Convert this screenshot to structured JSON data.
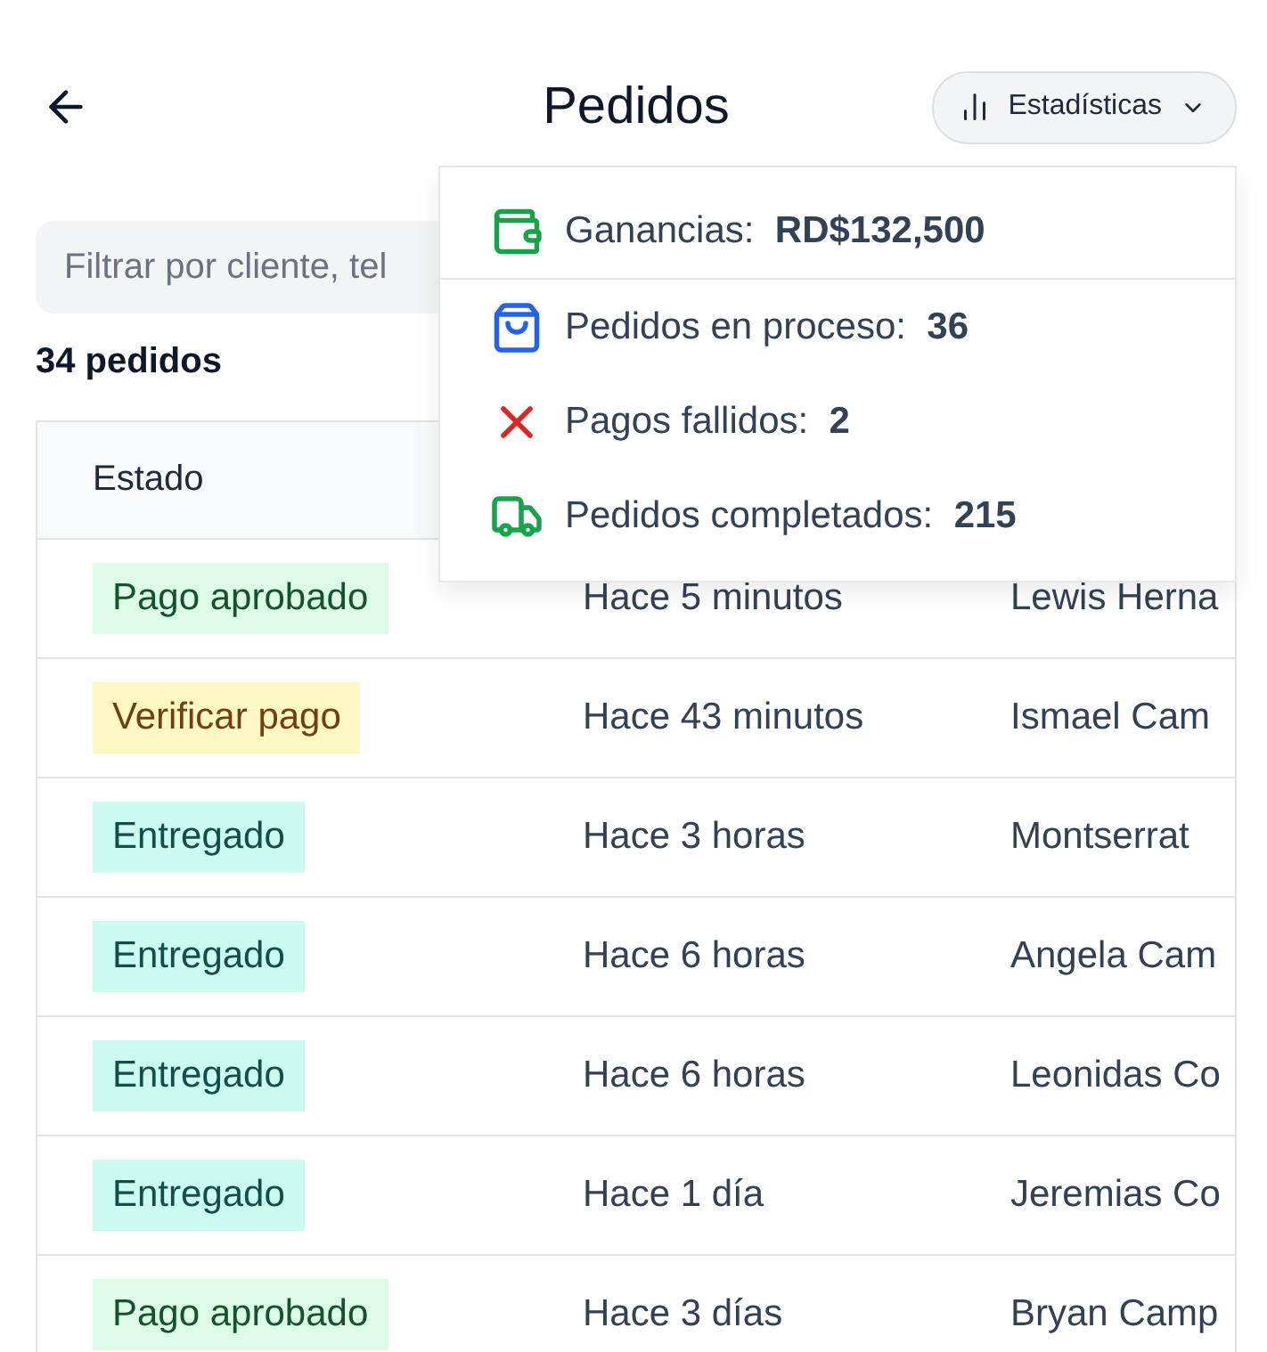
{
  "header": {
    "title": "Pedidos",
    "stats_button": "Estadísticas"
  },
  "stats_menu": [
    {
      "kind": "wallet",
      "label": "Ganancias:",
      "value": "RD$132,500",
      "color": "#16a34a",
      "divider": true
    },
    {
      "kind": "bag",
      "label": "Pedidos en proceso:",
      "value": "36",
      "color": "#2563eb",
      "divider": false
    },
    {
      "kind": "cross",
      "label": "Pagos fallidos:",
      "value": "2",
      "color": "#dc2626",
      "divider": false
    },
    {
      "kind": "truck",
      "label": "Pedidos completados:",
      "value": "215",
      "color": "#16a34a",
      "divider": false
    }
  ],
  "search": {
    "placeholder": "Filtrar por cliente, tel"
  },
  "count": "34 pedidos",
  "table": {
    "columns": [
      "Estado"
    ],
    "rows": [
      {
        "status": "Pago aprobado",
        "kind": "approved",
        "time": "Hace 5 minutos",
        "customer": "Lewis Herna"
      },
      {
        "status": "Verificar pago",
        "kind": "verify",
        "time": "Hace 43 minutos",
        "customer": "Ismael Cam"
      },
      {
        "status": "Entregado",
        "kind": "delivered",
        "time": "Hace 3 horas",
        "customer": "Montserrat"
      },
      {
        "status": "Entregado",
        "kind": "delivered",
        "time": "Hace 6 horas",
        "customer": "Angela Cam"
      },
      {
        "status": "Entregado",
        "kind": "delivered",
        "time": "Hace 6 horas",
        "customer": "Leonidas Co"
      },
      {
        "status": "Entregado",
        "kind": "delivered",
        "time": "Hace 1 día",
        "customer": "Jeremias Co"
      },
      {
        "status": "Pago aprobado",
        "kind": "approved",
        "time": "Hace 3 días",
        "customer": "Bryan Camp"
      }
    ]
  }
}
